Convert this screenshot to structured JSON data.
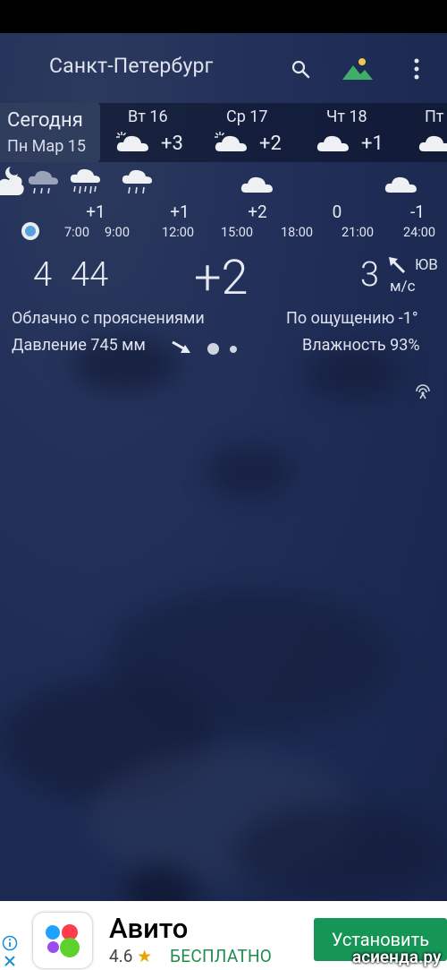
{
  "header": {
    "city": "Санкт-Петербург",
    "icons": [
      "search-icon",
      "landscape-icon",
      "more-vert-icon"
    ]
  },
  "days": {
    "today": {
      "label": "Сегодня",
      "date": "Пн Мар 15"
    },
    "items": [
      {
        "name": "Вт 16",
        "temp": "+3",
        "icon": "partly-cloudy-icon"
      },
      {
        "name": "Ср 17",
        "temp": "+2",
        "icon": "partly-cloudy-icon"
      },
      {
        "name": "Чт 18",
        "temp": "+1",
        "icon": "cloud-icon"
      },
      {
        "name": "Пт",
        "temp": "",
        "icon": "cloud-icon"
      }
    ]
  },
  "hourly": {
    "temps": [
      "+1",
      "+1",
      "+2",
      "0",
      "-1"
    ],
    "times": [
      "7:00",
      "9:00",
      "12:00",
      "15:00",
      "18:00",
      "21:00",
      "24:00"
    ],
    "icons": [
      "moon-cloud-icon",
      "rain-cloud-icon",
      "heavy-rain-cloud-icon",
      "rain-cloud-icon",
      "cloud-icon",
      "cloud-icon"
    ]
  },
  "current": {
    "time_hours": "4",
    "time_minutes": "44",
    "temperature": "+2",
    "condition": "Облачно с прояснениями",
    "pressure": "Давление 745 мм",
    "wind_speed": "3",
    "wind_dir": "ЮВ",
    "wind_unit": "м/с",
    "feels_like": "По ощущению -1°",
    "humidity": "Влажность 93%"
  },
  "ad": {
    "app_name": "Авито",
    "rating": "4.6",
    "price": "БЕСПЛАТНО",
    "install_label": "Установить"
  },
  "watermark": "асиенда.ру"
}
